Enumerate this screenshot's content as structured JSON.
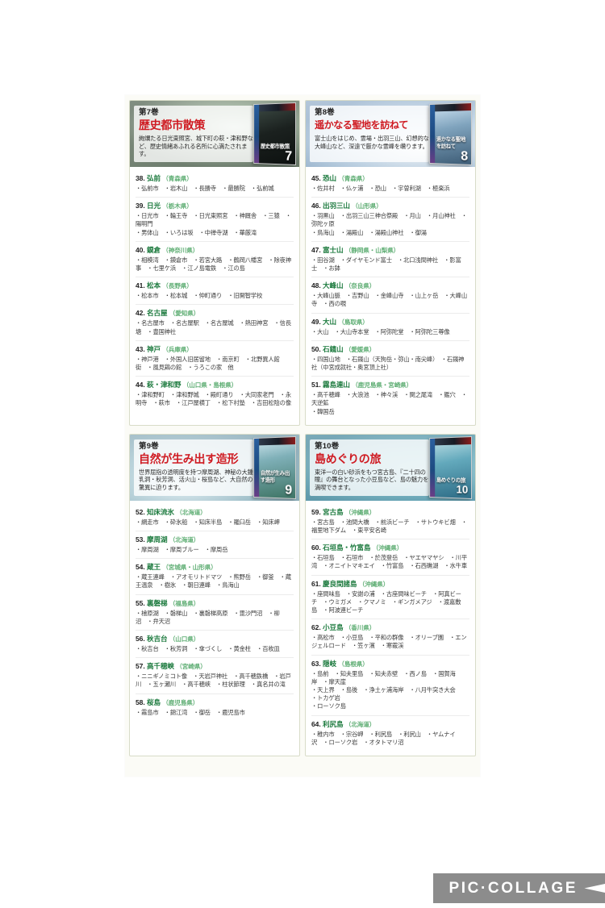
{
  "watermark": {
    "label": "PIC·COLLAGE"
  },
  "panels": [
    {
      "volume_no": "第7巻",
      "title": "歴史都市散策",
      "description": "絢爛たる日光東照宮、城下町の萩・津和野など、歴史情緒あふれる名所に心満たされます。",
      "disc_number": "7",
      "disc_caption": "歴史都市散策",
      "entries": [
        {
          "no": "38.",
          "name": "弘前",
          "pref": "（青森県）",
          "places": "・弘前市　・岩木山　・長勝寺　・最勝院　・弘前城"
        },
        {
          "no": "39.",
          "name": "日光",
          "pref": "（栃木県）",
          "places": "・日光市　・輪王寺　・日光東照宮　・神厩舎　・三猿　・陽明門\n・男体山　・いろは坂　・中禅寺湖　・華厳滝"
        },
        {
          "no": "40.",
          "name": "鏌倉",
          "pref": "（神奈川県）",
          "places": "・相模湾　・鏌倉市　・若宮大路　・鶴岡八幡宮　・除夜神事　・七里ケ浜　・江ノ島電鉄　・江の島"
        },
        {
          "no": "41.",
          "name": "松本",
          "pref": "（長野県）",
          "places": "・松本市　・松本城　・仲町通り　・旧開智学校"
        },
        {
          "no": "42.",
          "name": "名古屋",
          "pref": "（愛知県）",
          "places": "・名古屋市　・名古屋駅　・名古屋城　・熱田神宮　・信長塘　・豊国神社"
        },
        {
          "no": "43.",
          "name": "神戸",
          "pref": "（兵庫県）",
          "places": "・神戸港　・外国人旧居留地　・南京町　・北野異人館街　・風見鶏の館　・うろこの家　他"
        },
        {
          "no": "44.",
          "name": "萩・津和野",
          "pref": "（山口県・島根県）",
          "places": "・津和野町　・津和野城　・殿町通り　・大同家老門　・永明寺　・萩市　・江戸屋横丁　・松下村塾　・吉田松陰の像"
        }
      ]
    },
    {
      "volume_no": "第8巻",
      "title": "遥かなる聖地を訪ねて",
      "description": "富士山をはじめ、霊場・出羽三山、幻想的な大峰山など、深遠で厳かな霊峰を巑ります。",
      "disc_number": "8",
      "disc_caption": "遥かなる聖地を訪ねて",
      "entries": [
        {
          "no": "45.",
          "name": "恐山",
          "pref": "（青森県）",
          "places": "・佐井村　・仏ヶ浦　・恐山　・宇曽利湖　・極楽浜"
        },
        {
          "no": "46.",
          "name": "出羽三山",
          "pref": "（山形県）",
          "places": "・羽黒山　・出羽三山三神合祭殿　・月山　・月山神社　・弥陀ヶ原\n・鳥海山　・湯殿山　・湯殿山神社　・御湯"
        },
        {
          "no": "47.",
          "name": "富士山",
          "pref": "（静岡県・山梨県）",
          "places": "・田谷湖　・ダイヤモンド富士　・北口浅間神社　・影富士　・お鉢"
        },
        {
          "no": "48.",
          "name": "大峰山",
          "pref": "（奈良県）",
          "places": "・大峰山脈　・吉野山　・金峰山寺　・山上ヶ岳　・大峰山寺　・西の覗"
        },
        {
          "no": "49.",
          "name": "大山",
          "pref": "（鳥取県）",
          "places": "・大山　・大山寺本堂　・阿弥陀堂　・阿弥陀三尊像"
        },
        {
          "no": "50.",
          "name": "石鑧山",
          "pref": "（愛媛県）",
          "places": "・四国山地　・石鑧山（天狗岳・弥山・南尖峰）　・石鑧神社（中宮成就社・奥宮頂上社）"
        },
        {
          "no": "51.",
          "name": "霧島連山",
          "pref": "（鹿児島県・宮崎県）",
          "places": "・高千穂峰　・大浪池　・神々渓　・関之尾滝　・鑑穴　・天逆鉱\n・韓国岳"
        }
      ]
    },
    {
      "volume_no": "第9巻",
      "title": "自然が生み出す造形",
      "description": "世界屈指の透明度を持つ摩周湖、神秘の大鍾乳洞・秋芳洞、活火山・桜島など、大自然の驚異に迫ります。",
      "disc_number": "9",
      "disc_caption": "自然が生み出す造形",
      "entries": [
        {
          "no": "52.",
          "name": "知床流氷",
          "pref": "（北海道）",
          "places": "・網走市　・砕氷船　・知床半島　・羅臼岳　・知床岬"
        },
        {
          "no": "53.",
          "name": "摩周湖",
          "pref": "（北海道）",
          "places": "・摩周湖　・摩周ブルー　・摩周岳"
        },
        {
          "no": "54.",
          "name": "蔵王",
          "pref": "（宮城県・山形県）",
          "places": "・蔵王連峰　・アオモリトドマツ　・熊野岳　・御釜　・蔵王温泉　・樹氷　・朝日連峰　・鳥海山"
        },
        {
          "no": "55.",
          "name": "裏磐梯",
          "pref": "（福島県）",
          "places": "・檜原湖　・磐梯山　・裏磐梯高原　・毘沙門沼　・柳沼　・弁天沼"
        },
        {
          "no": "56.",
          "name": "秋吉台",
          "pref": "（山口県）",
          "places": "・秋吉台　・秋芳洞　・傘づくし　・黄金柱　・百枚皿"
        },
        {
          "no": "57.",
          "name": "高千穂峡",
          "pref": "（宮崎県）",
          "places": "・ニニギノミコト像　・天岩戸神社　・高千穂鉄橋　・岩戸川　・五ヶ瀬川　・高千穂峡　・柱状節理　・真名井の滝"
        },
        {
          "no": "58.",
          "name": "桜島",
          "pref": "（鹿児島県）",
          "places": "・霧島市　・錦江湾　・御岳　・鹿児島市"
        }
      ]
    },
    {
      "volume_no": "第10巻",
      "title": "島めぐりの旅",
      "description": "東洋一の白い砂浜をもつ宮古島、『二十四の瞳』の舞台となった小豆島など、島の魅力を満喫できます。",
      "disc_number": "10",
      "disc_caption": "島めぐりの旅",
      "entries": [
        {
          "no": "59.",
          "name": "宮古島",
          "pref": "（沖縄県）",
          "places": "・宮古島　・池間大橋　・前浜ビーチ　・サトウキビ畑　・福里地下ダム　・東平安名崎"
        },
        {
          "no": "60.",
          "name": "石垣島・竹富島",
          "pref": "（沖縄県）",
          "places": "・石垣島　・石垣市　・於茂登岳　・ヤエヤマヤシ　・川平湾　・オニイトマキエイ　・竹富島　・石西礁湖　・水牛車"
        },
        {
          "no": "61.",
          "name": "慶良間諸島",
          "pref": "（沖縄県）",
          "places": "・座間味島　・安謝の浦　・古座間味ビーチ　・阿真ビーチ　・ウミガメ　・クマノミ　・ギンガメアジ　・渡嘉敷島　・阿波連ビーチ"
        },
        {
          "no": "62.",
          "name": "小豆島",
          "pref": "（香川県）",
          "places": "・高松市　・小豆島　・平和の群像　・オリーブ園　・エンジェルロード　・笠ヶ濱　・寒霰渓"
        },
        {
          "no": "63.",
          "name": "隠岐",
          "pref": "（島根県）",
          "places": "・島前　・知夫里島　・知夫赤壁　・西ノ島　・国賀海岸　・摩天崖\n・天上界　・島後　・浄土ヶ浦海岸　・八月牛突き大会\n・トカゲ岩\n・ローソク島"
        },
        {
          "no": "64.",
          "name": "利尻島",
          "pref": "（北海道）",
          "places": "・稚内市　・宗谷岬　・利尻島　・利尻山　・ヤムナイ沢　・ローソク岩　・オタトマリ沼"
        }
      ]
    }
  ],
  "colors": {
    "title_red": "#cf1b22",
    "entry_green": "#1c7a3e",
    "pref_green": "#5fae74",
    "panel_border": "#d8dcc8",
    "watermark_bg": "#8c8c8c"
  }
}
